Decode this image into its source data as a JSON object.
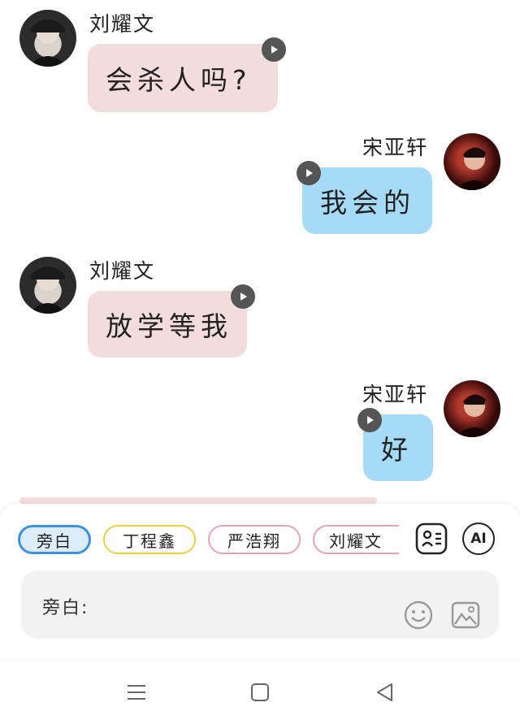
{
  "messages": [
    {
      "side": "left",
      "speaker": "刘耀文",
      "text": "会杀人吗?"
    },
    {
      "side": "right",
      "speaker": "宋亚轩",
      "text": "我会的"
    },
    {
      "side": "left",
      "speaker": "刘耀文",
      "text": "放学等我"
    },
    {
      "side": "right",
      "speaker": "宋亚轩",
      "text": "好"
    }
  ],
  "role_chips": [
    {
      "label": "旁白",
      "selected": true,
      "color": "#3d8fe0"
    },
    {
      "label": "丁程鑫",
      "selected": false,
      "color": "#f0cf3a"
    },
    {
      "label": "严浩翔",
      "selected": false,
      "color": "#e8a3b8"
    },
    {
      "label": "刘耀文",
      "selected": false,
      "color": "#e8a3b8"
    }
  ],
  "toolbar": {
    "ai_label": "AI"
  },
  "composer": {
    "prefix": "旁白:",
    "value": ""
  },
  "icons": {
    "play": "play-icon",
    "contacts": "contact-card-icon",
    "emoji": "smile-icon",
    "image": "image-icon",
    "menu": "menu-icon",
    "home": "square-icon",
    "back": "triangle-back-icon"
  },
  "colors": {
    "left_bubble": "#f2dcdc",
    "right_bubble": "#a6dbf7",
    "selected_chip_bg": "#dcecf9"
  }
}
